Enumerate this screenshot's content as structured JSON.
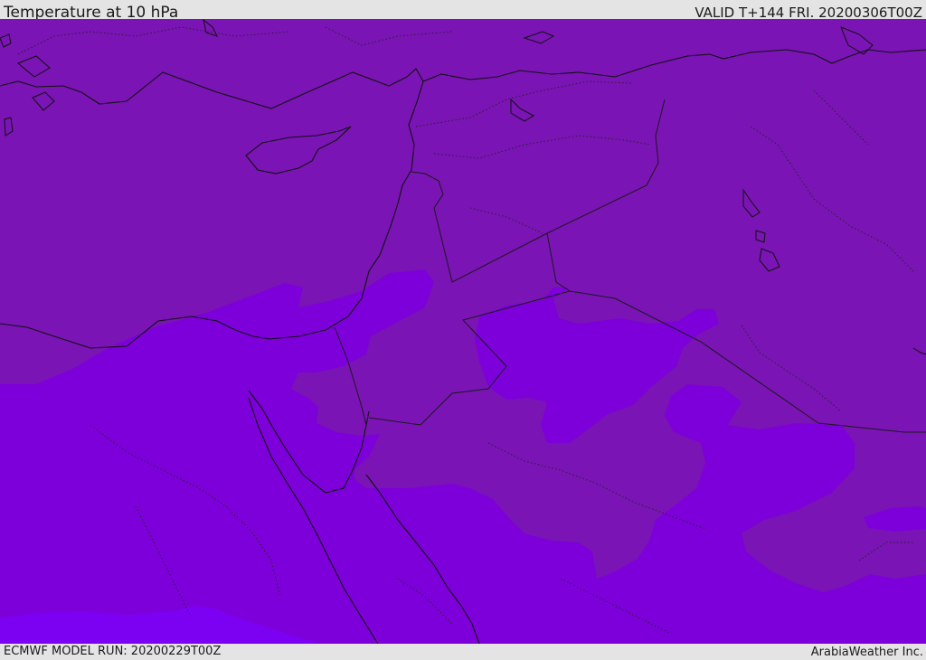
{
  "header": {
    "title": "Temperature at 10 hPa",
    "valid": "VALID T+144 FRI. 20200306T00Z"
  },
  "footer": {
    "model_run": "ECMWF MODEL RUN: 20200229T00Z",
    "credit": "ArabiaWeather Inc."
  },
  "colors": {
    "band_warm": "#7a14b4",
    "band_mid": "#7d00da",
    "band_cool": "#7c00f2",
    "coast": "#111111",
    "border": "#1a1a1a"
  }
}
